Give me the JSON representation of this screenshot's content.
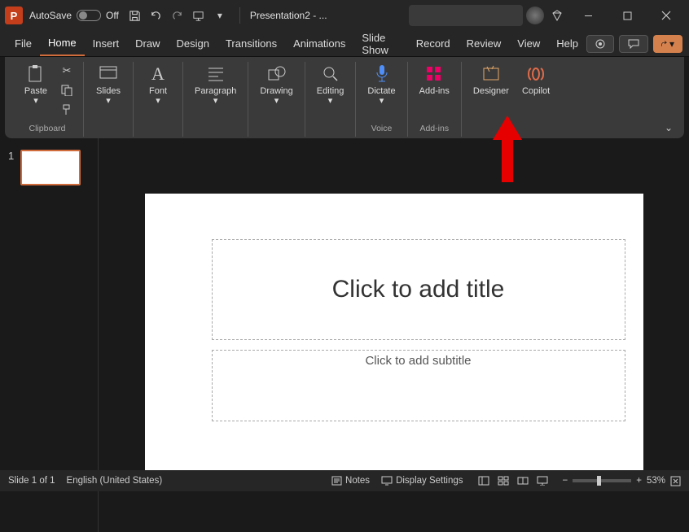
{
  "titlebar": {
    "autosave_label": "AutoSave",
    "autosave_state": "Off",
    "doc_title": "Presentation2 - ..."
  },
  "tabs": {
    "items": [
      "File",
      "Home",
      "Insert",
      "Draw",
      "Design",
      "Transitions",
      "Animations",
      "Slide Show",
      "Record",
      "Review",
      "View",
      "Help"
    ],
    "active_index": 1
  },
  "ribbon": {
    "clipboard": {
      "paste": "Paste",
      "label": "Clipboard"
    },
    "slides": {
      "btn": "Slides"
    },
    "font": {
      "btn": "Font"
    },
    "paragraph": {
      "btn": "Paragraph"
    },
    "drawing": {
      "btn": "Drawing"
    },
    "editing": {
      "btn": "Editing"
    },
    "voice": {
      "dictate": "Dictate",
      "label": "Voice"
    },
    "addins": {
      "btn": "Add-ins",
      "label": "Add-ins"
    },
    "designer": {
      "btn": "Designer"
    },
    "copilot": {
      "btn": "Copilot"
    }
  },
  "thumb": {
    "num": "1"
  },
  "slide": {
    "title_placeholder": "Click to add title",
    "subtitle_placeholder": "Click to add subtitle"
  },
  "status": {
    "slide_counter": "Slide 1 of 1",
    "language": "English (United States)",
    "notes": "Notes",
    "display": "Display Settings",
    "zoom_pct": "53%"
  }
}
